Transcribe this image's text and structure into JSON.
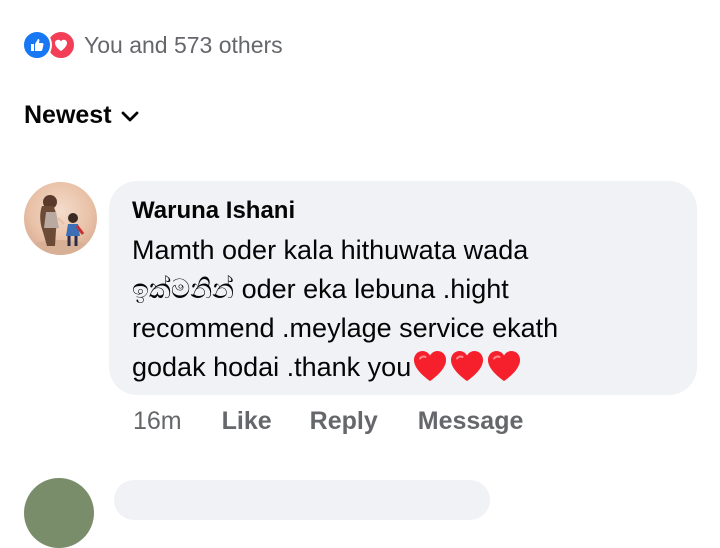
{
  "reactions": {
    "icons": [
      "like-icon",
      "love-icon"
    ],
    "summary": "You and 573 others"
  },
  "sort": {
    "label": "Newest",
    "icon": "chevron-down-icon"
  },
  "comment": {
    "author": "Waruna Ishani",
    "lines": [
      "Mamth oder kala hithuwata wada",
      "ඉක්මනින් oder eka lebuna .hight",
      "recommend .meylage service ekath",
      "godak hodai .thank you"
    ],
    "trailing_emoji": [
      "heart-icon",
      "heart-icon",
      "heart-icon"
    ],
    "time": "16m",
    "actions": {
      "like": "Like",
      "reply": "Reply",
      "message": "Message"
    }
  },
  "colors": {
    "like_blue": "#1877f2",
    "love_red": "#f33e58",
    "bubble_bg": "#f0f2f5",
    "meta_gray": "#65676b"
  }
}
